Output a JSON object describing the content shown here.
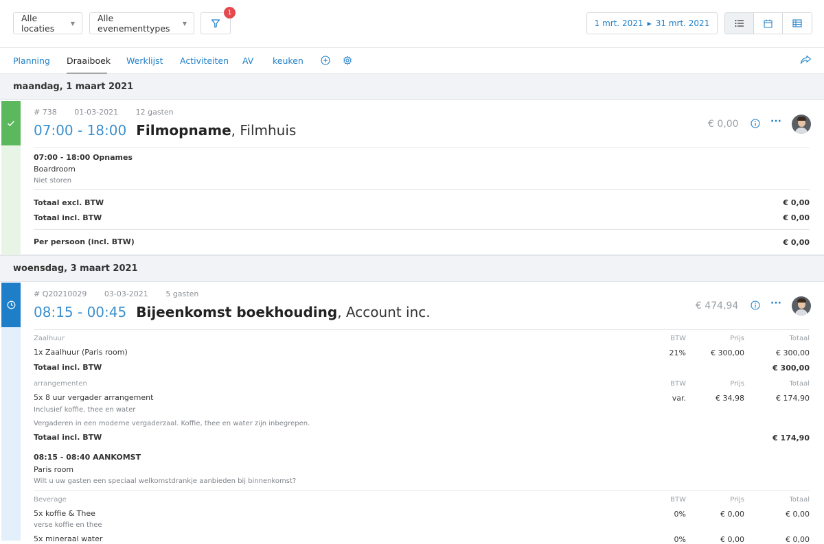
{
  "toolbar": {
    "location_select": "Alle locaties",
    "eventtype_select": "Alle evenementtypes",
    "filter_count": "1",
    "date_from": "1 mrt. 2021",
    "date_to": "31 mrt. 2021"
  },
  "tabs": [
    {
      "label": "Planning"
    },
    {
      "label": "Draaiboek"
    },
    {
      "label": "Werklijst"
    },
    {
      "label": "Activiteiten"
    },
    {
      "label": "AV"
    },
    {
      "label": "keuken"
    }
  ],
  "days": [
    {
      "heading": "maandag, 1 maart 2021",
      "event": {
        "number": "# 738",
        "date": "01-03-2021",
        "guests": "12 gasten",
        "time": "07:00 - 18:00",
        "name": "Filmopname",
        "client": ", Filmhuis",
        "price": "€ 0,00",
        "status_color": "#5cb85c",
        "activity": {
          "time_title": "07:00 - 18:00  Opnames",
          "room": "Boardroom",
          "note": "Niet storen"
        },
        "totals": {
          "excl_label": "Totaal excl. BTW",
          "excl_value": "€ 0,00",
          "incl_label": "Totaal incl. BTW",
          "incl_value": "€ 0,00",
          "pp_label": "Per persoon (incl. BTW)",
          "pp_value": "€ 0,00"
        }
      }
    },
    {
      "heading": "woensdag, 3 maart 2021",
      "event": {
        "number": "# Q20210029",
        "date": "03-03-2021",
        "guests": "5 gasten",
        "time": "08:15 - 00:45",
        "name": "Bijeenkomst boekhouding",
        "client": ", Account inc.",
        "price": "€ 474,94",
        "status_color": "#1e7fc8",
        "columns": {
          "btw": "BTW",
          "prijs": "Prijs",
          "totaal": "Totaal"
        },
        "sections": {
          "zaalhuur": {
            "title": "Zaalhuur",
            "line": {
              "desc": "1x Zaalhuur (Paris room)",
              "btw": "21%",
              "price": "€ 300,00",
              "total": "€ 300,00"
            },
            "total_label": "Totaal incl. BTW",
            "total_value": "€ 300,00"
          },
          "arrangementen": {
            "title": "arrangementen",
            "line": {
              "desc": "5x 8 uur vergader arrangement",
              "sub": "Inclusief koffie, thee en water",
              "btw": "var.",
              "price": "€ 34,98",
              "total": "€ 174,90"
            },
            "note": "Vergaderen in een moderne vergaderzaal. Koffie, thee en water zijn inbegrepen.",
            "total_label": "Totaal incl. BTW",
            "total_value": "€ 174,90"
          },
          "aankomst": {
            "time_title": "08:15 - 08:40  AANKOMST",
            "room": "Paris room",
            "note": "Wilt u uw gasten een speciaal welkomstdrankje aanbieden bij binnenkomst?"
          },
          "beverage": {
            "title": "Beverage",
            "line1": {
              "desc": "5x koffie & Thee",
              "sub": "verse koffie en thee",
              "btw": "0%",
              "price": "€ 0,00",
              "total": "€ 0,00"
            },
            "line2": {
              "desc": "5x mineraal water",
              "btw": "0%",
              "price": "€ 0,00",
              "total": "€ 0,00"
            }
          }
        }
      }
    }
  ]
}
